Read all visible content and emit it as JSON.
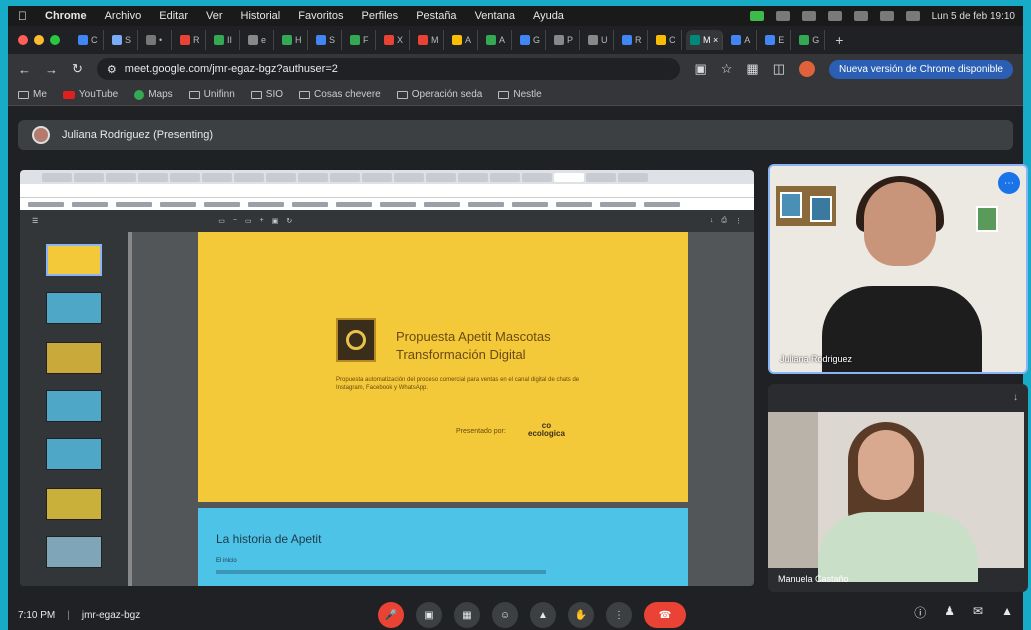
{
  "menubar": {
    "items": [
      "Chrome",
      "Archivo",
      "Editar",
      "Ver",
      "Historial",
      "Favoritos",
      "Perfiles",
      "Pestaña",
      "Ventana",
      "Ayuda"
    ],
    "clock": "Lun 5 de feb 19:10"
  },
  "browser": {
    "url": "meet.google.com/jmr-egaz-bgz?authuser=2",
    "update_label": "Nueva versión de Chrome disponible"
  },
  "bookmarks": [
    "Me",
    "YouTube",
    "Maps",
    "Unifinn",
    "SIO",
    "Cosas chevere",
    "Operación seda",
    "Nestle"
  ],
  "meet": {
    "presenter_label": "Juliana Rodriguez (Presenting)",
    "meeting_time": "7:10 PM",
    "meeting_code": "jmr-egaz-bgz",
    "participant1_name": "Juliana Rodriguez",
    "participant2_name": "Manuela Castaño"
  },
  "shared": {
    "slide_title_line1": "Propuesta Apetit Mascotas",
    "slide_title_line2": "Transformación Digital",
    "slide_subtitle": "Propuesta automatización del proceso comercial para ventas en el canal digital de chats de Instagram, Facebook y WhatsApp.",
    "presented_by": "Presentado por:",
    "presenter_brand": "ecologica",
    "slide2_title": "La historia de Apetit",
    "slide2_line": "El inicio"
  }
}
